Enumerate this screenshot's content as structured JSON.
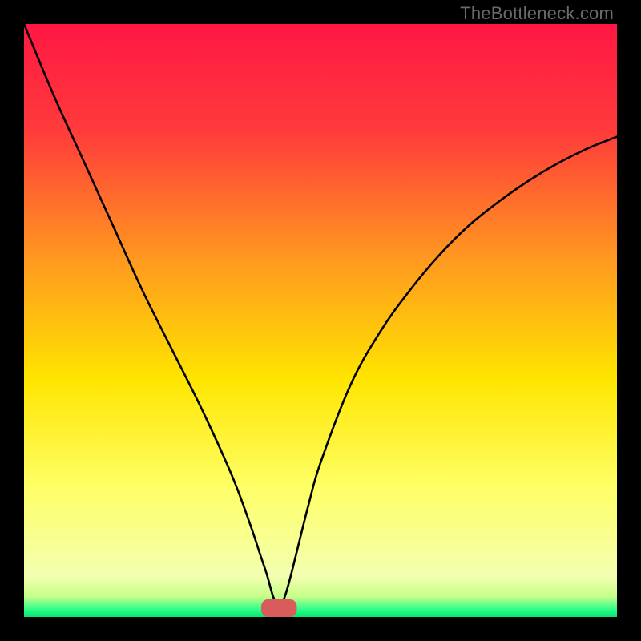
{
  "watermark": "TheBottleneck.com",
  "chart_data": {
    "type": "line",
    "title": "",
    "xlabel": "",
    "ylabel": "",
    "xlim": [
      0,
      100
    ],
    "ylim": [
      0,
      100
    ],
    "gradient_stops": [
      {
        "offset": 0.0,
        "color": "#ff1744"
      },
      {
        "offset": 0.18,
        "color": "#ff3b3b"
      },
      {
        "offset": 0.4,
        "color": "#ff9a1f"
      },
      {
        "offset": 0.6,
        "color": "#ffe500"
      },
      {
        "offset": 0.78,
        "color": "#ffff66"
      },
      {
        "offset": 0.93,
        "color": "#f3ffb0"
      },
      {
        "offset": 0.965,
        "color": "#c8ff8a"
      },
      {
        "offset": 0.985,
        "color": "#3cff8a"
      },
      {
        "offset": 1.0,
        "color": "#00e676"
      }
    ],
    "bottleneck_x": 43,
    "marker": {
      "x": 43,
      "y": 1.5,
      "width": 6,
      "height": 3,
      "color": "#d95b5b"
    },
    "series": [
      {
        "name": "bottleneck-curve",
        "x": [
          0,
          5,
          10,
          15,
          20,
          25,
          30,
          35,
          38,
          40,
          41,
          42,
          43,
          44,
          45,
          46,
          48,
          50,
          55,
          60,
          65,
          70,
          75,
          80,
          85,
          90,
          95,
          100
        ],
        "values": [
          100,
          88,
          77,
          66,
          55,
          45,
          35,
          24,
          16,
          10,
          7,
          3.5,
          1.5,
          3.5,
          7,
          11,
          19,
          26,
          39,
          48,
          55,
          61,
          66,
          70,
          73.5,
          76.5,
          79,
          81
        ]
      }
    ]
  }
}
